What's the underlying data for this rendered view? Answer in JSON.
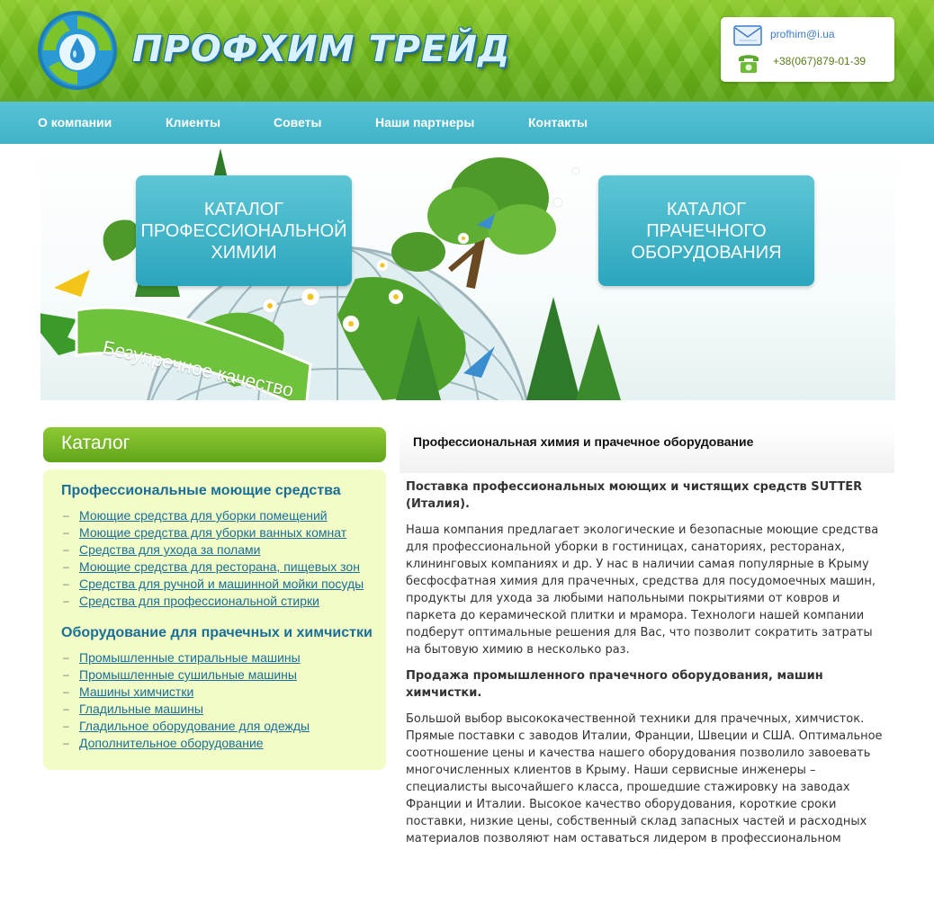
{
  "header": {
    "logo_text": "ПРОФХИМ ТРЕЙД",
    "email": "profhim@i.ua",
    "phone": "+38(067)879-01-39"
  },
  "nav": {
    "items": [
      "О компании",
      "Клиенты",
      "Советы",
      "Наши партнеры",
      "Контакты"
    ]
  },
  "banner": {
    "catalog_chem": [
      "КАТАЛОГ",
      "ПРОФЕССИОНАЛЬНОЙ",
      "ХИМИИ"
    ],
    "catalog_laundry": [
      "КАТАЛОГ",
      "ПРАЧЕЧНОГО",
      "ОБОРУДОВАНИЯ"
    ],
    "ribbon": "Безупречное качество"
  },
  "sidebar": {
    "title": "Каталог",
    "sections": [
      {
        "title": "Профессиональные моющие средства",
        "items": [
          "Моющие средства для уборки помещений",
          "Моющие средства для уборки ванных комнат",
          "Средства для ухода за полами",
          "Моющие средства для ресторана, пищевых зон",
          "Средства для ручной и машинной мойки посуды",
          "Средства для профессиональной стирки"
        ]
      },
      {
        "title": "Оборудование для прачечных и химчистки",
        "items": [
          "Промышленные стиральные машины",
          "Промышленные сушильные машины",
          "Машины химчистки",
          "Гладильные машины",
          "Гладильное оборудование для одежды",
          "Дополнительное оборудование"
        ]
      }
    ]
  },
  "main": {
    "heading": "Профессиональная химия и прачечное оборудование",
    "paragraphs": [
      {
        "bold": true,
        "text": "Поставка профессиональных моющих и чистящих средств SUTTER (Италия)."
      },
      {
        "bold": false,
        "text": "Наша компания предлагает экологические и безопасные моющие средства для профессиональной уборки в гостиницах, санаториях, ресторанах, клининговых компаниях и др. У нас в наличии самая популярные в Крыму бесфосфатная химия для прачечных, средства для посудомоечных машин, продукты для ухода за любыми напольными покрытиями от ковров и паркета до керамической плитки и мрамора. Технологи нашей компании подберут оптимальные решения для Вас, что позволит сократить затраты на бытовую химию в несколько раз."
      },
      {
        "bold": true,
        "text": "Продажа промышленного прачечного оборудования, машин химчистки."
      },
      {
        "bold": false,
        "text": "Большой выбор высококачественной техники для прачечных, химчисток. Прямые поставки с заводов Италии, Франции, Швеции и США. Оптимальное соотношение цены и качества нашего оборудования позволило завоевать многочисленных клиентов в Крыму. Наши сервисные инженеры – специалисты высочайшего класса, прошедшие стажировку на заводах Франции и Италии. Высокое качество оборудования, короткие сроки поставки, низкие цены, собственный склад запасных частей и расходных материалов позволяют нам оставаться лидером в профессиональном"
      }
    ]
  }
}
